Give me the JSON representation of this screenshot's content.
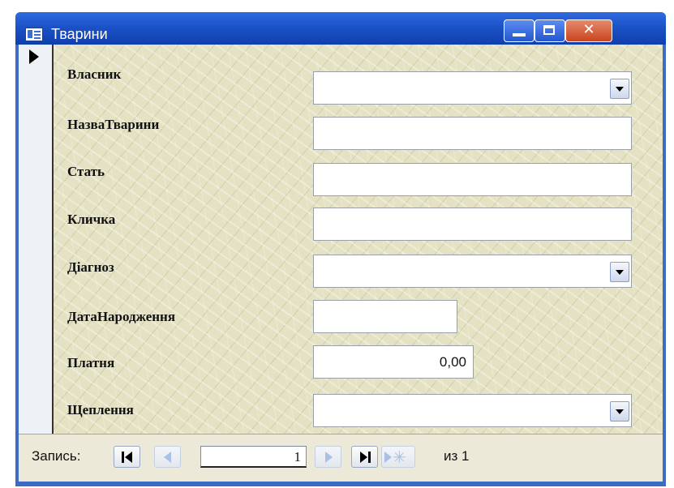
{
  "window": {
    "title": "Тварини"
  },
  "form": {
    "fields": [
      {
        "label": "Власник",
        "value": "",
        "type": "combo"
      },
      {
        "label": "НазваТварини",
        "value": "",
        "type": "text"
      },
      {
        "label": "Стать",
        "value": "",
        "type": "text"
      },
      {
        "label": "Кличка",
        "value": "",
        "type": "text"
      },
      {
        "label": "Діагноз",
        "value": "",
        "type": "combo"
      },
      {
        "label": "ДатаНародження",
        "value": "",
        "type": "text"
      },
      {
        "label": "Платня",
        "value": "0,00",
        "type": "text"
      },
      {
        "label": "Щеплення",
        "value": "",
        "type": "combo"
      }
    ]
  },
  "navigation": {
    "record_label": "Запись:",
    "current_record": "1",
    "of_label": "из",
    "total_records": "1"
  }
}
